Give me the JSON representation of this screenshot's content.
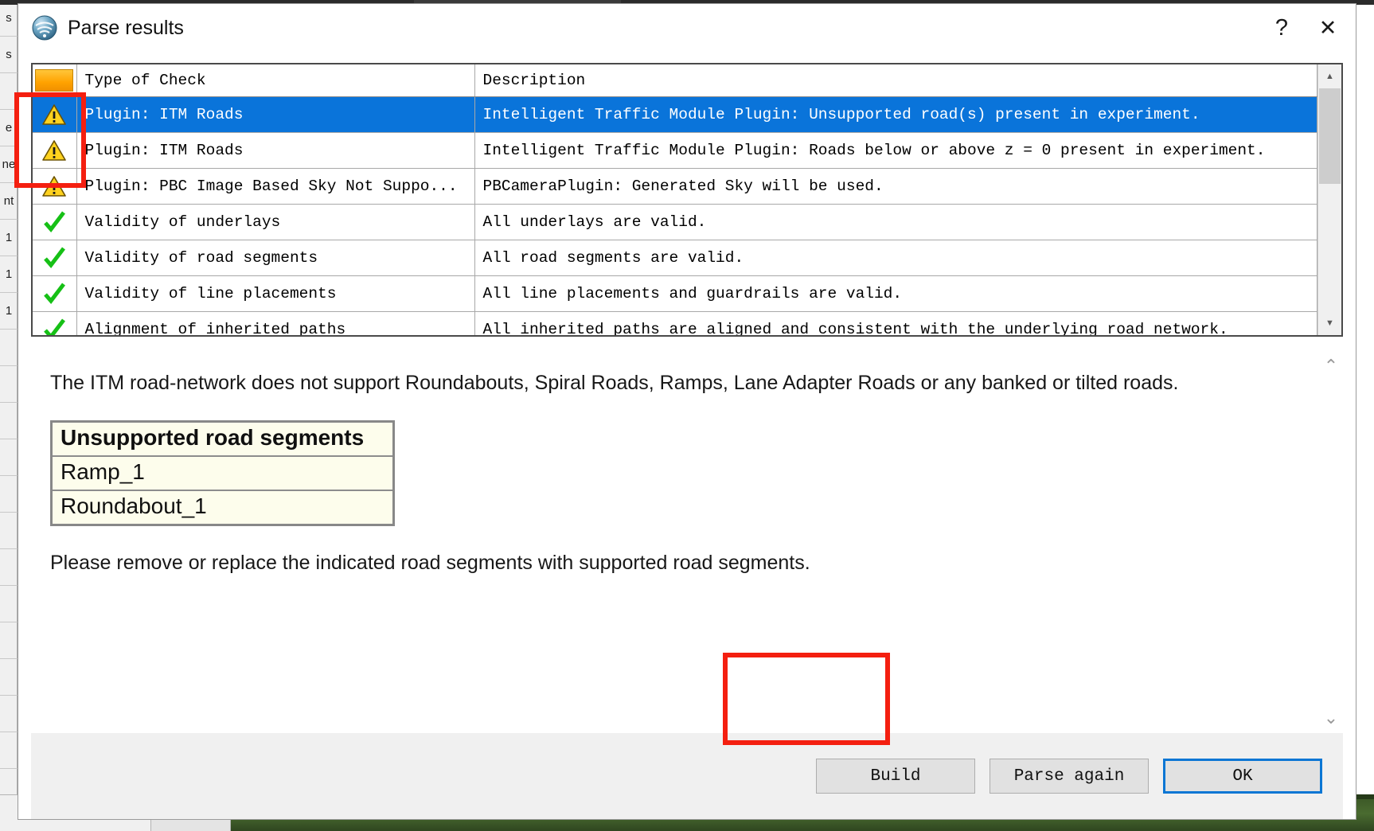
{
  "background": {
    "left_rail_labels": [
      "s",
      "s",
      "",
      "e",
      "ne",
      "nt",
      "1",
      "1",
      "1",
      "",
      "",
      "",
      "",
      "",
      "",
      "",
      "",
      "",
      "",
      "",
      "",
      ""
    ]
  },
  "window": {
    "title": "Parse results",
    "icon": "app-globe-icon",
    "help_label": "?",
    "close_label": "✕"
  },
  "grid": {
    "columns": [
      "",
      "Type of Check",
      "Description"
    ],
    "rows": [
      {
        "status": "warning",
        "type": "Plugin: ITM Roads",
        "description": "Intelligent Traffic Module Plugin: Unsupported road(s) present in experiment.",
        "selected": true
      },
      {
        "status": "warning",
        "type": "Plugin: ITM Roads",
        "description": "Intelligent Traffic Module Plugin: Roads below or above z = 0 present in experiment.",
        "selected": false
      },
      {
        "status": "warning",
        "type": "Plugin: PBC Image Based Sky Not Suppo...",
        "description": "PBCameraPlugin: Generated Sky will be used.",
        "selected": false
      },
      {
        "status": "ok",
        "type": "Validity of underlays",
        "description": "All underlays are valid.",
        "selected": false
      },
      {
        "status": "ok",
        "type": "Validity of road segments",
        "description": "All road segments are valid.",
        "selected": false
      },
      {
        "status": "ok",
        "type": "Validity of line placements",
        "description": "All line placements and guardrails are valid.",
        "selected": false
      },
      {
        "status": "ok",
        "type": "Alignment of inherited paths",
        "description": "All inherited paths are aligned and consistent with the underlying road network.",
        "selected": false
      }
    ],
    "scroll_up_icon": "▲",
    "scroll_down_icon": "▼"
  },
  "detail": {
    "lead_text": "The ITM road-network does not support Roundabouts, Spiral Roads, Ramps, Lane Adapter Roads or any banked or tilted roads.",
    "segments_table": {
      "header": "Unsupported road segments",
      "rows": [
        "Ramp_1",
        "Roundabout_1"
      ]
    },
    "tail_text": "Please remove or replace the indicated road segments with supported road segments.",
    "scroll_up_icon": "⌃",
    "scroll_down_icon": "⌄"
  },
  "footer": {
    "build_label": "Build",
    "parse_again_label": "Parse again",
    "ok_label": "OK"
  },
  "colors": {
    "selection_blue": "#0a74da",
    "default_button_border": "#0b76d4",
    "annotation_red": "#f41f10",
    "warning_yellow": "#ffd21e",
    "ok_green": "#16c016",
    "header_swatch_orange": "#ffa200",
    "segments_table_bg": "#fdfdec"
  },
  "annotations": [
    {
      "name": "warning-icons-highlight",
      "target": "grid status icons"
    },
    {
      "name": "build-button-highlight",
      "target": "Build button"
    }
  ]
}
